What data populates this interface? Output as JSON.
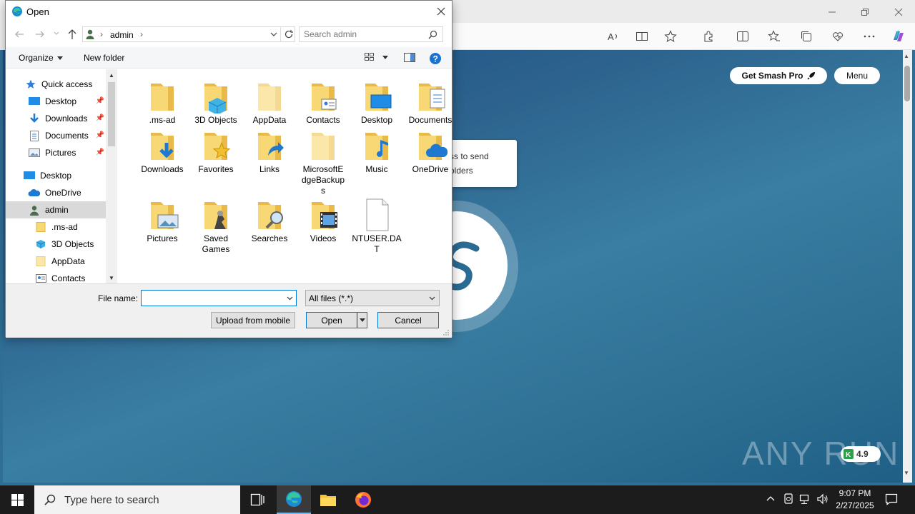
{
  "browser": {
    "toolbar_icons": [
      "read-aloud-icon",
      "immersive-reader-icon",
      "favorite-star-icon",
      "extensions-icon",
      "split-screen-icon",
      "favorites-icon",
      "collections-icon",
      "browser-essentials-icon",
      "more-icon",
      "copilot-icon"
    ],
    "window_controls": [
      "minimize-icon",
      "restore-icon",
      "close-icon"
    ]
  },
  "page": {
    "get_pro_label": "Get Smash Pro",
    "menu_label": "Menu",
    "tooltip_line1": "ss to send",
    "tooltip_line2": "olders",
    "watermark": "ANY RUN",
    "rating": "4.9"
  },
  "dialog": {
    "title": "Open",
    "breadcrumb": "admin",
    "search_placeholder": "Search admin",
    "organize_label": "Organize",
    "new_folder_label": "New folder",
    "nav_items": [
      {
        "label": "Quick access",
        "icon": "star-icon",
        "pinned": false
      },
      {
        "label": "Desktop",
        "icon": "desktop-icon",
        "pinned": true
      },
      {
        "label": "Downloads",
        "icon": "downloads-icon",
        "pinned": true
      },
      {
        "label": "Documents",
        "icon": "documents-icon",
        "pinned": true
      },
      {
        "label": "Pictures",
        "icon": "pictures-icon",
        "pinned": true
      },
      {
        "label": "Desktop",
        "icon": "desktop-icon",
        "pinned": false
      },
      {
        "label": "OneDrive",
        "icon": "onedrive-icon",
        "pinned": false
      },
      {
        "label": "admin",
        "icon": "user-icon",
        "pinned": false,
        "selected": true
      },
      {
        "label": ".ms-ad",
        "icon": "folder-icon",
        "pinned": false
      },
      {
        "label": "3D Objects",
        "icon": "3d-objects-icon",
        "pinned": false
      },
      {
        "label": "AppData",
        "icon": "folder-icon",
        "pinned": false
      },
      {
        "label": "Contacts",
        "icon": "contacts-icon",
        "pinned": false
      }
    ],
    "files": [
      {
        "name": ".ms-ad",
        "icon": "folder-icon"
      },
      {
        "name": "3D Objects",
        "icon": "3d-objects-folder-icon"
      },
      {
        "name": "AppData",
        "icon": "folder-icon"
      },
      {
        "name": "Contacts",
        "icon": "contacts-folder-icon"
      },
      {
        "name": "Desktop",
        "icon": "desktop-folder-icon"
      },
      {
        "name": "Documents",
        "icon": "documents-folder-icon"
      },
      {
        "name": "Downloads",
        "icon": "downloads-folder-icon"
      },
      {
        "name": "Favorites",
        "icon": "favorites-folder-icon"
      },
      {
        "name": "Links",
        "icon": "links-folder-icon"
      },
      {
        "name": "MicrosoftEdgeBackups",
        "display": "MicrosoftE\ndgeBackup\ns",
        "icon": "folder-icon"
      },
      {
        "name": "Music",
        "icon": "music-folder-icon"
      },
      {
        "name": "OneDrive",
        "icon": "onedrive-folder-icon"
      },
      {
        "name": "Pictures",
        "icon": "pictures-folder-icon"
      },
      {
        "name": "Saved Games",
        "display": "Saved\nGames",
        "icon": "saved-games-folder-icon"
      },
      {
        "name": "Searches",
        "icon": "searches-folder-icon"
      },
      {
        "name": "Videos",
        "icon": "videos-folder-icon"
      },
      {
        "name": "NTUSER.DAT",
        "display": "NTUSER.DA\nT",
        "icon": "file-icon"
      }
    ],
    "filename_label": "File name:",
    "filename_value": "",
    "filetype_value": "All files (*.*)",
    "upload_label": "Upload from mobile",
    "open_label": "Open",
    "cancel_label": "Cancel"
  },
  "taskbar": {
    "search_placeholder": "Type here to search",
    "time": "9:07 PM",
    "date": "2/27/2025"
  },
  "colors": {
    "accent": "#0078d7",
    "folder": "#f8d775",
    "page_gradient": "#2c628d"
  }
}
